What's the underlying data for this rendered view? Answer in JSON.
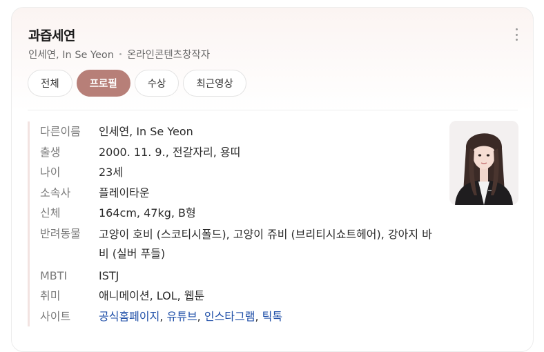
{
  "header": {
    "title": "과즙세연",
    "subtitle_name": "인세연, In Se Yeon",
    "subtitle_role": "온라인콘텐츠창작자"
  },
  "tabs": [
    {
      "label": "전체",
      "active": false
    },
    {
      "label": "프로필",
      "active": true
    },
    {
      "label": "수상",
      "active": false
    },
    {
      "label": "최근영상",
      "active": false
    }
  ],
  "profile": {
    "other_name": {
      "key": "다른이름",
      "value": "인세연, In Se Yeon"
    },
    "birth": {
      "key": "출생",
      "value": "2000. 11. 9., 전갈자리, 용띠"
    },
    "age": {
      "key": "나이",
      "value": "23세"
    },
    "agency": {
      "key": "소속사",
      "value": "플레이타운"
    },
    "body": {
      "key": "신체",
      "value": "164cm, 47kg, B형"
    },
    "pets": {
      "key": "반려동물",
      "value": "고양이 호비 (스코티시폴드), 고양이 쥬비 (브리티시쇼트헤어), 강아지 바비 (실버 푸들)"
    },
    "mbti": {
      "key": "MBTI",
      "value": "ISTJ"
    },
    "hobby": {
      "key": "취미",
      "value": "애니메이션, LOL, 웹툰"
    },
    "site": {
      "key": "사이트",
      "links": [
        "공식홈페이지",
        "유튜브",
        "인스타그램",
        "틱톡"
      ]
    }
  },
  "colors": {
    "accent": "#b77f78",
    "link": "#1f4fa8"
  },
  "icons": {
    "more": "more-vertical-icon"
  }
}
